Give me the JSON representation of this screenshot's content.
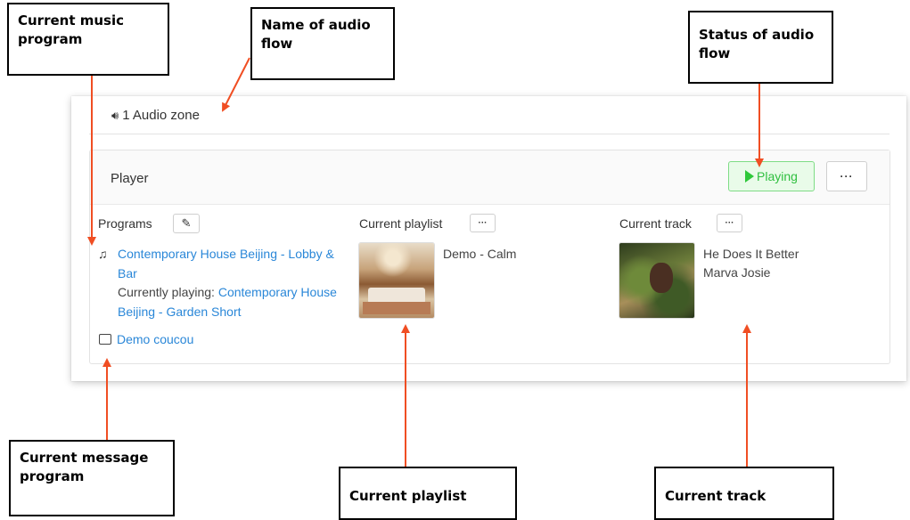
{
  "callouts": {
    "music_program": "Current music program",
    "audio_flow_name": "Name of audio flow",
    "audio_flow_status": "Status of audio flow",
    "message_program": "Current message program",
    "current_playlist": "Current playlist",
    "current_track": "Current track"
  },
  "zone": {
    "icon": "speaker-icon",
    "title": "1 Audio zone"
  },
  "player": {
    "title": "Player",
    "status_label": "Playing",
    "status_color": "#2fbf3f",
    "more_label": "···"
  },
  "programs": {
    "label": "Programs",
    "edit_icon": "edit-icon",
    "music_program": "Contemporary House Beijing - Lobby & Bar",
    "currently_playing_prefix": "Currently playing: ",
    "currently_playing": "Contemporary House Beijing - Garden Short",
    "message_program": "Demo coucou"
  },
  "playlist": {
    "label": "Current playlist",
    "more_label": "···",
    "name": "Demo - Calm"
  },
  "track": {
    "label": "Current track",
    "more_label": "···",
    "title": "He Does It Better",
    "artist": "Marva Josie"
  },
  "colors": {
    "link": "#2a87d8",
    "arrow": "#f04e23"
  }
}
